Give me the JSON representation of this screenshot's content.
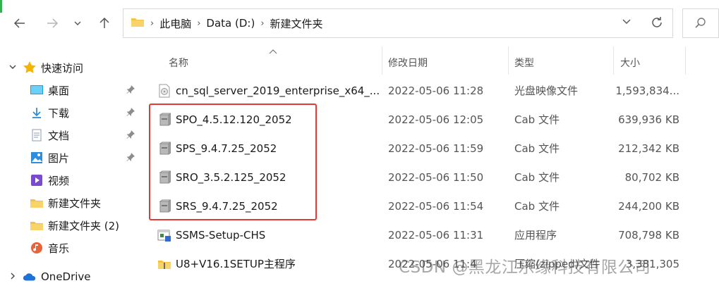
{
  "address": {
    "crumbs": [
      "此电脑",
      "Data (D:)",
      "新建文件夹"
    ]
  },
  "nav": {
    "quick_access": "快速访问",
    "items": [
      {
        "label": "桌面",
        "icon": "desktop-icon",
        "pinned": true
      },
      {
        "label": "下载",
        "icon": "download-icon",
        "pinned": true
      },
      {
        "label": "文档",
        "icon": "document-icon",
        "pinned": true
      },
      {
        "label": "图片",
        "icon": "pictures-icon",
        "pinned": true
      },
      {
        "label": "视频",
        "icon": "video-icon",
        "pinned": false
      },
      {
        "label": "新建文件夹",
        "icon": "folder-icon",
        "pinned": false
      },
      {
        "label": "新建文件夹 (2)",
        "icon": "folder-icon",
        "pinned": false
      },
      {
        "label": "音乐",
        "icon": "music-icon",
        "pinned": false
      }
    ],
    "onedrive": "OneDrive"
  },
  "columns": {
    "name": "名称",
    "date": "修改日期",
    "type": "类型",
    "size": "大小"
  },
  "files": [
    {
      "name": "cn_sql_server_2019_enterprise_x64_...",
      "date": "2022-05-06 11:28",
      "type": "光盘映像文件",
      "size": "1,593,834...",
      "icon": "disc-image-icon"
    },
    {
      "name": "SPO_4.5.12.120_2052",
      "date": "2022-05-06 12:05",
      "type": "Cab 文件",
      "size": "639,936 KB",
      "icon": "cab-file-icon"
    },
    {
      "name": "SPS_9.4.7.25_2052",
      "date": "2022-05-06 11:59",
      "type": "Cab 文件",
      "size": "212,342 KB",
      "icon": "cab-file-icon"
    },
    {
      "name": "SRO_3.5.2.125_2052",
      "date": "2022-05-06 11:50",
      "type": "Cab 文件",
      "size": "80,702 KB",
      "icon": "cab-file-icon"
    },
    {
      "name": "SRS_9.4.7.25_2052",
      "date": "2022-05-06 11:54",
      "type": "Cab 文件",
      "size": "244,200 KB",
      "icon": "cab-file-icon"
    },
    {
      "name": "SSMS-Setup-CHS",
      "date": "2022-05-06 11:31",
      "type": "应用程序",
      "size": "708,798 KB",
      "icon": "installer-icon"
    },
    {
      "name": "U8+V16.1SETUP主程序",
      "date": "2022-05-06 11:4",
      "type": "压缩(zipped)文件",
      "size": "3,381,305",
      "icon": "zip-folder-icon"
    }
  ],
  "watermark": "CSDN @黑龙江乐缘科技有限公司",
  "colors": {
    "highlight": "#e53935",
    "star": "#f5b400",
    "folder": "#f3c443"
  }
}
